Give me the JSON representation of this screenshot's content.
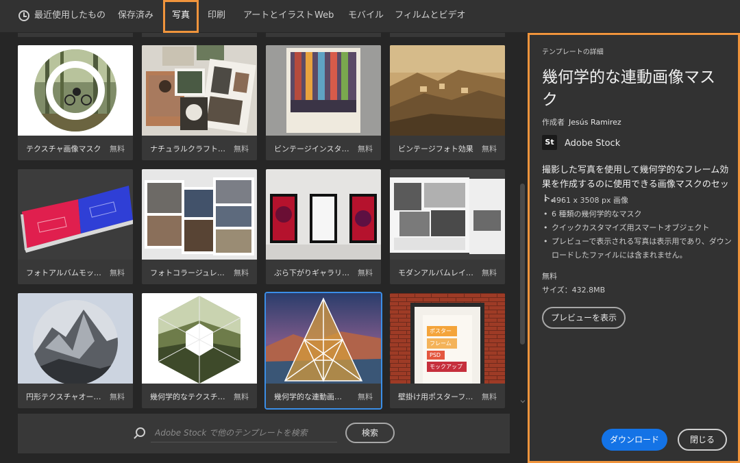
{
  "tabs": {
    "recent": "最近使用したもの",
    "saved": "保存済み",
    "photo": "写真",
    "print": "印刷",
    "art": "アートとイラスト",
    "web": "Web",
    "mobile": "モバイル",
    "film": "フィルムとビデオ"
  },
  "cards": [
    {
      "title": "テクスチャ画像マスク",
      "price": "無料",
      "thumb": "photo-icon-circle-bike"
    },
    {
      "title": "ナチュラルクラフトムード…",
      "price": "無料",
      "thumb": "moodboard"
    },
    {
      "title": "ビンテージインスタント…",
      "price": "無料",
      "thumb": "vintage-polaroid"
    },
    {
      "title": "ビンテージフォト効果",
      "price": "無料",
      "thumb": "vintage-coast"
    },
    {
      "title": "フォトアルバムモックア…",
      "price": "無料",
      "thumb": "photo-album"
    },
    {
      "title": "フォトコラージュレイアウト",
      "price": "無料",
      "thumb": "collage"
    },
    {
      "title": "ぶら下がりギャラリーフ…",
      "price": "無料",
      "thumb": "hanging-gallery"
    },
    {
      "title": "モダンアルバムレイアウト",
      "price": "無料",
      "thumb": "modern-album"
    },
    {
      "title": "円形テクスチャオーバー…",
      "price": "無料",
      "thumb": "circle-mountain"
    },
    {
      "title": "幾何学的なテクスチャ…",
      "price": "無料",
      "thumb": "hexagon-forest"
    },
    {
      "title": "幾何学的な連動画…",
      "price": "無料",
      "thumb": "geometric-triangle"
    },
    {
      "title": "壁掛け用ポスターフレ…",
      "price": "無料",
      "thumb": "poster-frame"
    }
  ],
  "poster_text": [
    "ポスター",
    "フレーム",
    "PSD",
    "モックアップ"
  ],
  "search": {
    "placeholder": "Adobe Stock で他のテンプレートを検索",
    "button": "検索"
  },
  "panel": {
    "header": "テンプレートの詳細",
    "title": "幾何学的な連動画像マスク",
    "author_label": "作成者",
    "author": "Jesús Ramirez",
    "source_logo": "St",
    "source": "Adobe Stock",
    "description": "撮影した写真を使用して幾何学的なフレーム効果を作成するのに使用できる画像マスクのセット。",
    "features": [
      "4961 x 3508 px 画像",
      "6 種類の幾何学的なマスク",
      "クイックカスタマイズ用スマートオブジェクト",
      "プレビューで表示される写真は表示用であり、ダウンロードしたファイルには含まれません。"
    ],
    "price": "無料",
    "size": "サイズ：432.8MB",
    "preview_button": "プレビューを表示",
    "download_button": "ダウンロード",
    "close_button": "閉じる"
  },
  "colors": {
    "accent": "#f0943c",
    "primary_button": "#1473e6",
    "selection": "#3b8fe8"
  }
}
